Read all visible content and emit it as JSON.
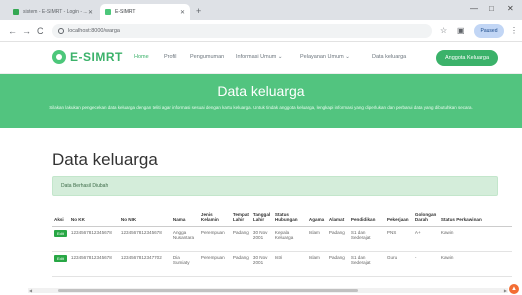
{
  "browser": {
    "tabs": [
      {
        "title": "sistem - E-SIMRT - Login - ...",
        "favicon_color": "#34a853"
      },
      {
        "title": "E-SIMRT",
        "favicon_color": "#4cc77a"
      }
    ],
    "new_tab": "+",
    "window_controls": [
      "—",
      "□",
      "✕"
    ],
    "nav": {
      "back": "←",
      "forward": "→",
      "reload": "C"
    },
    "url": "localhost:8000/warga",
    "profile_label": "Paused"
  },
  "site": {
    "brand": "E-SIMRT",
    "menu": [
      {
        "label": "Home",
        "active": true
      },
      {
        "label": "Profil",
        "active": false
      },
      {
        "label": "Pengumuman",
        "active": false
      },
      {
        "label": "Informasi Umum ⌄",
        "active": false
      },
      {
        "label": "Pelayanan Umum ⌄",
        "active": false
      },
      {
        "label": "Data keluarga",
        "active": false
      }
    ],
    "cta_label": "Anggota Keluarga"
  },
  "hero": {
    "title": "Data keluarga",
    "description": "Silakan lakukan pengecekan data keluarga dengan teliti agar informasi sesuai dengan kartu keluarga. Untuk tindak anggota keluarga, lengkapi informasi yang diperlukan dan perbarui data yang dibutuhkan secara."
  },
  "content": {
    "heading": "Data keluarga",
    "alert": "Data Berhasil Diubah",
    "table": {
      "columns": [
        "Aksi",
        "No KK",
        "No NIK",
        "Nama",
        "Jenis Kelamin",
        "Tempat Lahir",
        "Tanggal Lahir",
        "Status Hubungan",
        "Agama",
        "Alamat",
        "Pendidikan",
        "Pekerjaan",
        "Golongan Darah",
        "Status Perkawinan"
      ],
      "action_label": "Edit",
      "rows": [
        [
          "",
          "1234567812345678",
          "1234567812345678",
          "Angga Nusantara",
          "Perempuan",
          "Padang",
          "30 Nov 2001",
          "Kepala Keluarga",
          "Islam",
          "Padang",
          "S1 dan Sederajat",
          "PNS",
          "A+",
          "Kawin"
        ],
        [
          "",
          "1234567812345678",
          "1234567812347702",
          "Dia Sumiaty",
          "Perempuan",
          "Padang",
          "30 Nov 2001",
          "Istri",
          "Islam",
          "Padang",
          "S1 dan Sederajat",
          "Guru",
          "-",
          "Kawin"
        ]
      ]
    }
  },
  "colors": {
    "brand_green": "#3bb26a",
    "hero_green": "#52c47f",
    "alert_bg": "#d4edda",
    "button_green": "#28a745"
  },
  "icons": [
    "lock-icon",
    "star-icon",
    "extension-icon",
    "menu-dots-icon",
    "chat-icon"
  ]
}
